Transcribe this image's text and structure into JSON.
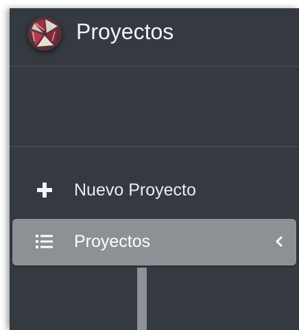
{
  "brand": {
    "name": "Proyectos",
    "logo_icon": "circular-stripes-logo"
  },
  "nav": {
    "items": [
      {
        "label": "Nuevo Proyecto",
        "icon": "plus-icon",
        "active": false
      },
      {
        "label": "Proyectos",
        "icon": "list-icon",
        "active": true,
        "expand_icon": "chevron-left-icon"
      }
    ]
  },
  "colors": {
    "sidebar_bg": "#343a40",
    "active_bg": "#8d9095",
    "text": "#e9ecef",
    "divider": "#4b545c"
  }
}
